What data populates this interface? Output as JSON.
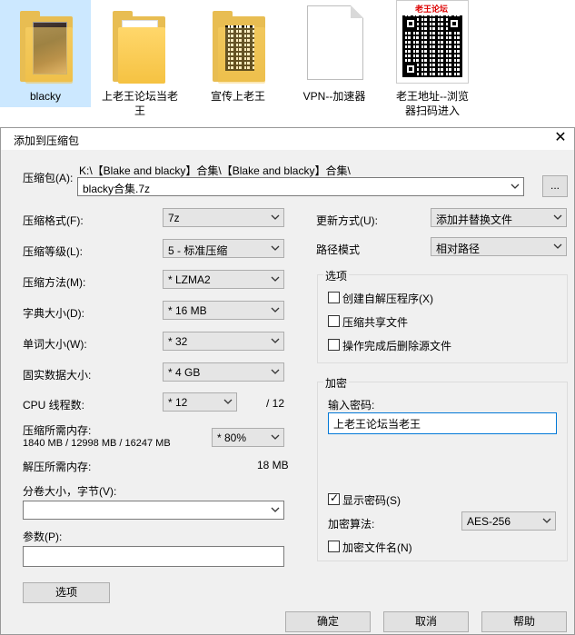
{
  "desktop": {
    "files": [
      {
        "name": "blacky"
      },
      {
        "name_line1": "上老王论坛当老",
        "name_line2": "王"
      },
      {
        "name": "宣传上老王"
      },
      {
        "name": "VPN--加速器"
      },
      {
        "name_line1": "老王地址--浏览",
        "name_line2": "器扫码进入",
        "badge": "老王论坛"
      }
    ]
  },
  "dialog": {
    "title": "添加到压缩包",
    "close": "✕",
    "archive": {
      "label": "压缩包(A):",
      "path": "K:\\【Blake and blacky】合集\\【Blake and blacky】合集\\",
      "filename": "blacky合集.7z",
      "browse": "..."
    },
    "left": {
      "format_label": "压缩格式(F):",
      "format_value": "7z",
      "level_label": "压缩等级(L):",
      "level_value": "5 - 标准压缩",
      "method_label": "压缩方法(M):",
      "method_value": "* LZMA2",
      "dict_label": "字典大小(D):",
      "dict_value": "* 16 MB",
      "word_label": "单词大小(W):",
      "word_value": "* 32",
      "solid_label": "固实数据大小:",
      "solid_value": "* 4 GB",
      "threads_label": "CPU 线程数:",
      "threads_value": "* 12",
      "threads_total": "/ 12",
      "mem_label": "压缩所需内存:",
      "mem_detail": "1840 MB / 12998 MB / 16247 MB",
      "mem_percent": "* 80%",
      "decomp_label": "解压所需内存:",
      "decomp_value": "18 MB",
      "split_label": "分卷大小，字节(V):",
      "split_value": "",
      "params_label": "参数(P):",
      "params_value": "",
      "options_button": "选项"
    },
    "right": {
      "update_label": "更新方式(U):",
      "update_value": "添加并替换文件",
      "pathmode_label": "路径模式",
      "pathmode_value": "相对路径",
      "options_group": "选项",
      "opt_sfx": "创建自解压程序(X)",
      "opt_shared": "压缩共享文件",
      "opt_delete": "操作完成后删除源文件",
      "enc_group": "加密",
      "password_label": "输入密码:",
      "password_value": "上老王论坛当老王",
      "show_password": "显示密码(S)",
      "enc_method_label": "加密算法:",
      "enc_method_value": "AES-256",
      "encrypt_names": "加密文件名(N)"
    },
    "buttons": {
      "ok": "确定",
      "cancel": "取消",
      "help": "帮助"
    }
  }
}
